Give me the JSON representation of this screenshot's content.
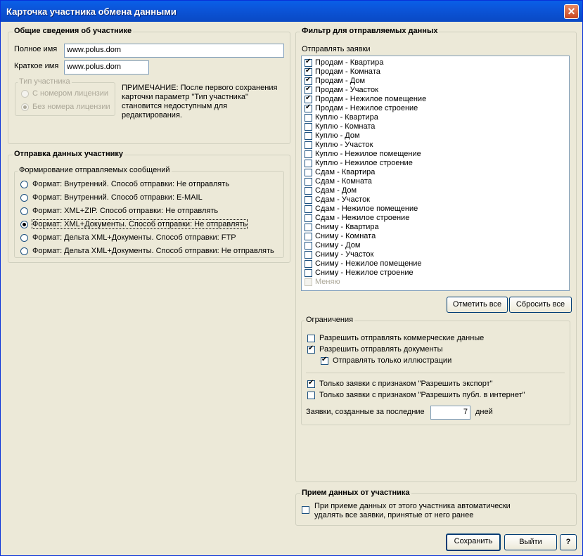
{
  "window": {
    "title": "Карточка участника обмена данными",
    "close_icon": "close-icon"
  },
  "general": {
    "legend": "Общие сведения об участнике",
    "full_name_label": "Полное имя",
    "full_name_value": "www.polus.dom",
    "short_name_label": "Краткое имя",
    "short_name_value": "www.polus.dom",
    "type_legend": "Тип участника",
    "type_option_1": "С номером лицензии",
    "type_option_2": "Без номера лицензии",
    "note_lines": [
      "ПРИМЕЧАНИЕ: После первого сохранения",
      "карточки параметр \"Тип участника\"",
      "становится недоступным для",
      "редактирования."
    ]
  },
  "sending": {
    "legend": "Отправка данных участнику",
    "formats_legend": "Формирование отправляемых сообщений",
    "options": [
      "Формат: Внутренний. Способ отправки: Не отправлять",
      "Формат: Внутренний. Способ отправки: E-MAIL",
      "Формат: XML+ZIP. Способ отправки: Не отправлять",
      "Формат: XML+Документы. Способ отправки: Не отправлять",
      "Формат: Дельта XML+Документы. Способ отправки: FTP",
      "Формат: Дельта XML+Документы. Способ отправки: Не отправлять"
    ],
    "selected_index": 3
  },
  "filter": {
    "legend": "Фильтр для отправляемых данных",
    "send_label": "Отправлять заявки",
    "items": [
      "Продам - Квартира",
      "Продам - Комната",
      "Продам - Дом",
      "Продам - Участок",
      "Продам - Нежилое помещение",
      "Продам - Нежилое строение",
      "Куплю - Квартира",
      "Куплю - Комната",
      "Куплю - Дом",
      "Куплю - Участок",
      "Куплю - Нежилое помещение",
      "Куплю - Нежилое строение",
      "Сдам - Квартира",
      "Сдам - Комната",
      "Сдам - Дом",
      "Сдам - Участок",
      "Сдам - Нежилое помещение",
      "Сдам - Нежилое строение",
      "Сниму - Квартира",
      "Сниму - Комната",
      "Сниму - Дом",
      "Сниму - Участок",
      "Сниму - Нежилое помещение",
      "Сниму - Нежилое строение",
      "Меняю"
    ],
    "checked_count": 6,
    "disabled_index": 24,
    "select_all": "Отметить все",
    "reset_all": "Сбросить все"
  },
  "restrictions": {
    "legend": "Ограничения",
    "allow_commercial": "Разрешить отправлять коммерческие данные",
    "allow_commercial_checked": false,
    "allow_documents": "Разрешить отправлять документы",
    "allow_documents_checked": true,
    "only_illustrations": "Отправлять только иллюстрации",
    "only_illustrations_checked": true,
    "only_export": "Только заявки с признаком \"Разрешить экспорт\"",
    "only_export_checked": true,
    "only_publish": "Только заявки с признаком \"Разрешить публ. в интернет\"",
    "only_publish_checked": false,
    "created_prefix": "Заявки, созданные за последние",
    "created_days": "7",
    "created_suffix": "дней"
  },
  "receive": {
    "legend": "Прием данных от участника",
    "auto_delete_line1": "При приеме данных от этого участника автоматически",
    "auto_delete_line2": "удалять все заявки, принятые от него ранее",
    "auto_delete_checked": false
  },
  "buttons": {
    "save": "Сохранить",
    "exit": "Выйти",
    "help": "?"
  }
}
